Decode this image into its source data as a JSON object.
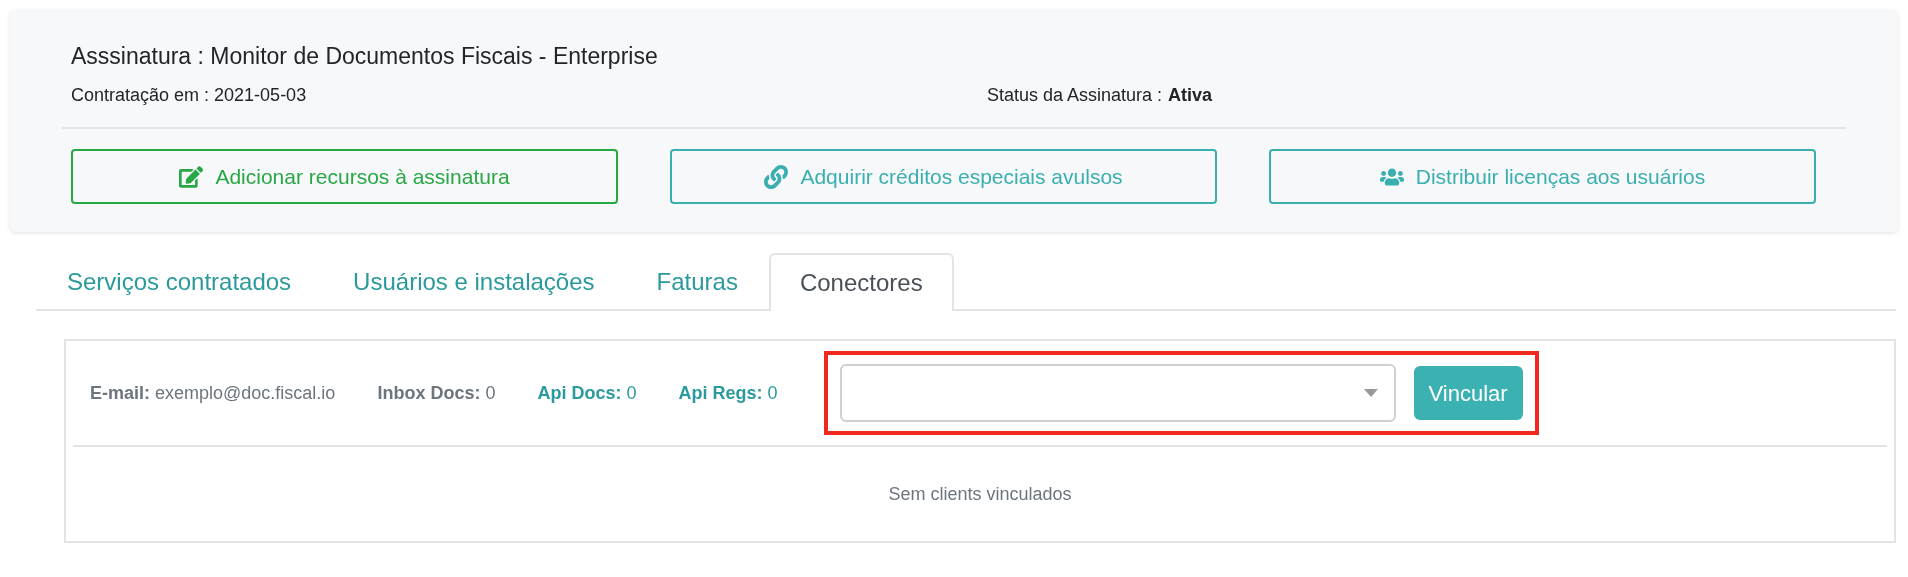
{
  "subscription": {
    "title": "Asssinatura : Monitor de Documentos Fiscais - Enterprise",
    "hired_label": "Contratação em : 2021-05-03",
    "status_label": "Status da Assinatura :",
    "status_value": "Ativa"
  },
  "actions": [
    {
      "kind": "edit",
      "label": "Adicionar recursos à assinatura"
    },
    {
      "kind": "link",
      "label": "Adquirir créditos especiais avulsos"
    },
    {
      "kind": "users",
      "label": "Distribuir licenças aos usuários"
    }
  ],
  "tabs": [
    {
      "label": "Serviços contratados",
      "selected": false
    },
    {
      "label": "Usuários e instalações",
      "selected": false
    },
    {
      "label": "Faturas",
      "selected": false
    },
    {
      "label": "Conectores",
      "selected": true
    }
  ],
  "connector": {
    "stats": [
      {
        "kind": "plain",
        "label": "E-mail:",
        "value": "exemplo@doc.fiscal.io"
      },
      {
        "kind": "plain",
        "label": "Inbox Docs:",
        "value": "0"
      },
      {
        "kind": "accent",
        "label": "Api Docs:",
        "value": "0"
      },
      {
        "kind": "accent",
        "label": "Api Regs:",
        "value": "0"
      }
    ],
    "highlighted": true,
    "button": "Vincular",
    "empty_message": "Sem clients vinculados"
  }
}
